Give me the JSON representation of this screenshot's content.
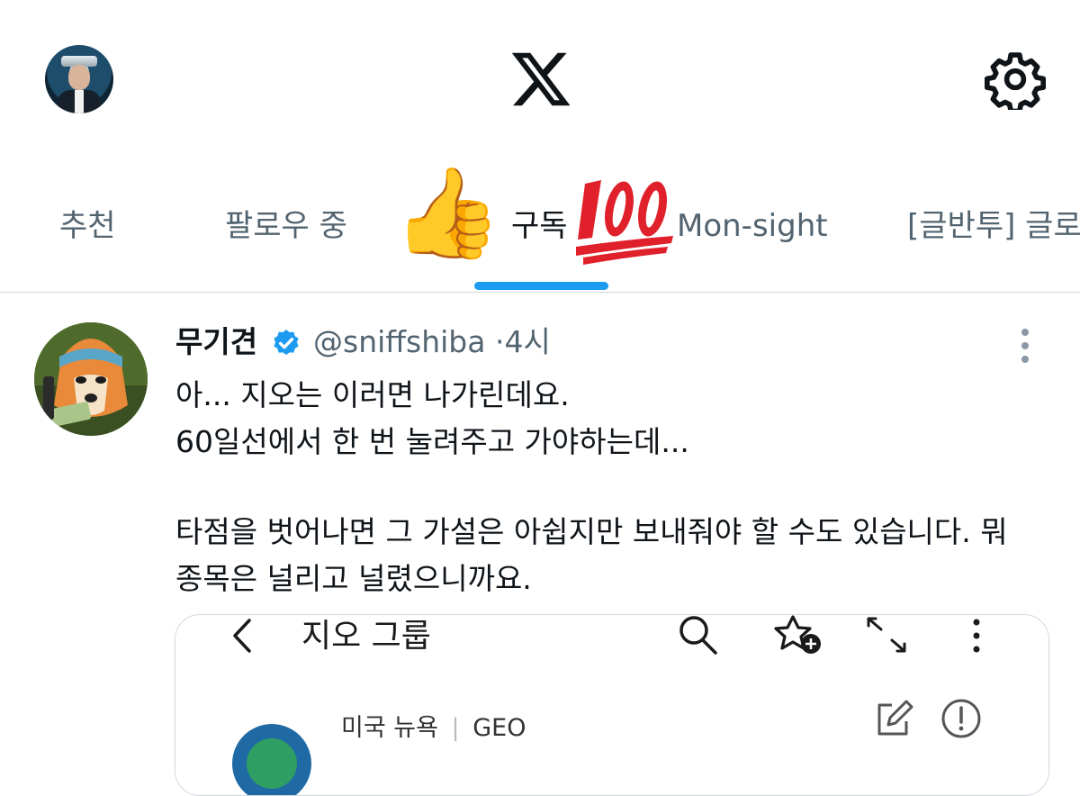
{
  "header": {
    "profile_avatar": "user-avatar",
    "logo": "x-logo-icon",
    "settings_icon": "gear-icon"
  },
  "tabs": [
    {
      "label": "추천",
      "active": false
    },
    {
      "label": "팔로우 중",
      "active": false
    },
    {
      "label": "구독",
      "active": true
    },
    {
      "label": "Mon-sight",
      "active": false
    },
    {
      "label": "[글반투] 글로",
      "active": false
    }
  ],
  "stickers": {
    "thumb": "👍",
    "hundred": "💯"
  },
  "tweet": {
    "name": "무기견",
    "handle": "@sniffshiba",
    "separator": "·",
    "time": "4시",
    "lines": [
      "아... 지오는 이러면 나가린데요.",
      "60일선에서 한 번 눌려주고 가야하는데...",
      "",
      "타점을 벗어나면 그 가설은 아쉽지만 보내줘야 할 수도 있습니다. 뭐",
      "종목은 널리고 널렸으니까요."
    ]
  },
  "embed": {
    "title": "지오 그룹",
    "subtitle_left": "미국 뉴욕",
    "subtitle_right": "GEO"
  },
  "colors": {
    "accent": "#1d9bf0",
    "muted": "#536471",
    "text": "#0f1419"
  }
}
